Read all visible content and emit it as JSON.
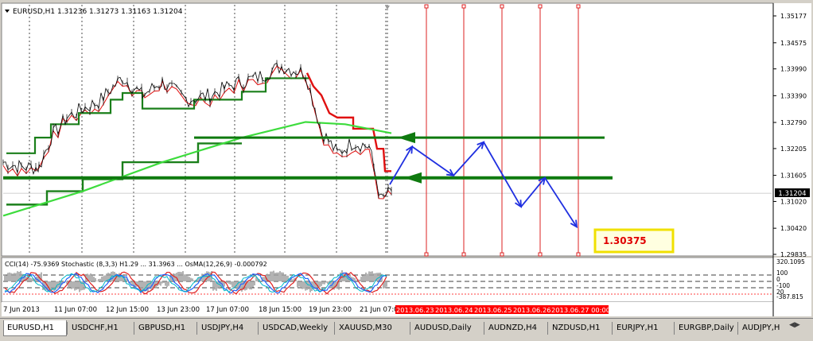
{
  "chart_header": "EURUSD,H1  1.31236 1.31273 1.31163 1.31204",
  "current_price": "1.31204",
  "annotation": "1.30375",
  "indicator_label": "CCI(14) -75.9369  Stochastic (8,3,3) H1.29  ...  31.3963  ...  OsMA(12,26,9) -0.000792",
  "colors": {
    "ma_red": "#e01010",
    "ma_dark_green": "#1a7f1a",
    "ma_light_green": "#3ddc3d",
    "support_green": "#0f7a0f",
    "projection_blue": "#1f2fe0",
    "future_dates_bg": "#ff0000",
    "grid_vline": "#dd2222"
  },
  "tabs": [
    "EURUSD,H1",
    "USDCHF,H1",
    "GBPUSD,H1",
    "USDJPY,H4",
    "USDCAD,Weekly",
    "XAUUSD,M30",
    "AUDUSD,Daily",
    "AUDNZD,H4",
    "NZDUSD,H1",
    "EURJPY,H1",
    "EURGBP,Daily",
    "AUDJPY,H"
  ],
  "chart_data": {
    "type": "line",
    "title": "EURUSD,H1  1.31236 1.31273 1.31163 1.31204",
    "ylim": [
      1.29835,
      1.35177
    ],
    "y_ticks": [
      "1.35177",
      "1.34575",
      "1.33990",
      "1.33390",
      "1.32790",
      "1.32205",
      "1.31605",
      "1.31020",
      "1.30420",
      "1.29835"
    ],
    "x_ticks": [
      "7 Jun 2013",
      "11 Jun 07:00",
      "12 Jun 15:00",
      "13 Jun 23:00",
      "17 Jun 07:00",
      "18 Jun 15:00",
      "19 Jun 23:00",
      "21 Jun 07:00"
    ],
    "future_dates": [
      "2013.06.23",
      "2013.06.24",
      "2013.06.25",
      "2013.06.26",
      "2013.06.27 00:00"
    ],
    "price_series_hint": [
      {
        "x": 0,
        "y": 1.319
      },
      {
        "x": 20,
        "y": 1.318
      },
      {
        "x": 45,
        "y": 1.3178
      },
      {
        "x": 60,
        "y": 1.3245
      },
      {
        "x": 80,
        "y": 1.329
      },
      {
        "x": 100,
        "y": 1.331
      },
      {
        "x": 120,
        "y": 1.3325
      },
      {
        "x": 150,
        "y": 1.338
      },
      {
        "x": 175,
        "y": 1.334
      },
      {
        "x": 200,
        "y": 1.337
      },
      {
        "x": 230,
        "y": 1.333
      },
      {
        "x": 260,
        "y": 1.334
      },
      {
        "x": 290,
        "y": 1.3365
      },
      {
        "x": 320,
        "y": 1.338
      },
      {
        "x": 350,
        "y": 1.3405
      },
      {
        "x": 380,
        "y": 1.339
      },
      {
        "x": 400,
        "y": 1.326
      },
      {
        "x": 420,
        "y": 1.321
      },
      {
        "x": 440,
        "y": 1.3235
      },
      {
        "x": 460,
        "y": 1.3225
      },
      {
        "x": 475,
        "y": 1.3105
      },
      {
        "x": 488,
        "y": 1.3125
      }
    ],
    "horizontal_levels": [
      {
        "name": "resistance",
        "y": 1.3245
      },
      {
        "name": "support",
        "y": 1.3155
      }
    ],
    "projection_path": [
      {
        "x": 490,
        "y": 1.314
      },
      {
        "x": 518,
        "y": 1.3225
      },
      {
        "x": 570,
        "y": 1.316
      },
      {
        "x": 608,
        "y": 1.3235
      },
      {
        "x": 655,
        "y": 1.309
      },
      {
        "x": 685,
        "y": 1.3155
      },
      {
        "x": 725,
        "y": 1.3045
      }
    ],
    "annotation_value": 1.30375
  }
}
